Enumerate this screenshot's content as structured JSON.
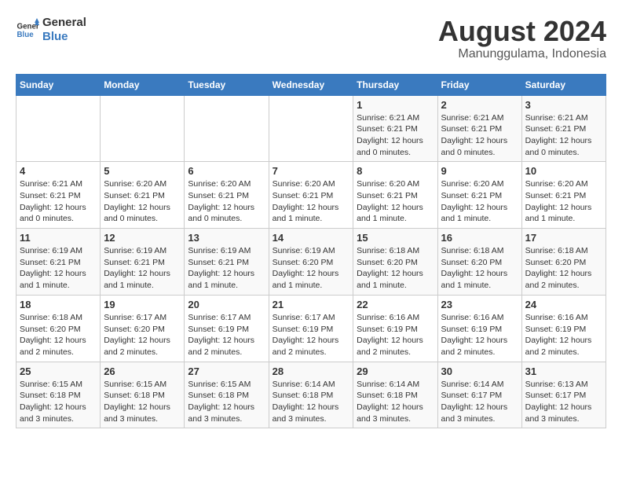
{
  "logo": {
    "line1": "General",
    "line2": "Blue"
  },
  "title": "August 2024",
  "subtitle": "Manunggulama, Indonesia",
  "header": {
    "days": [
      "Sunday",
      "Monday",
      "Tuesday",
      "Wednesday",
      "Thursday",
      "Friday",
      "Saturday"
    ]
  },
  "weeks": [
    {
      "cells": [
        {
          "day": "",
          "info": ""
        },
        {
          "day": "",
          "info": ""
        },
        {
          "day": "",
          "info": ""
        },
        {
          "day": "",
          "info": ""
        },
        {
          "day": "1",
          "info": "Sunrise: 6:21 AM\nSunset: 6:21 PM\nDaylight: 12 hours\nand 0 minutes."
        },
        {
          "day": "2",
          "info": "Sunrise: 6:21 AM\nSunset: 6:21 PM\nDaylight: 12 hours\nand 0 minutes."
        },
        {
          "day": "3",
          "info": "Sunrise: 6:21 AM\nSunset: 6:21 PM\nDaylight: 12 hours\nand 0 minutes."
        }
      ]
    },
    {
      "cells": [
        {
          "day": "4",
          "info": "Sunrise: 6:21 AM\nSunset: 6:21 PM\nDaylight: 12 hours\nand 0 minutes."
        },
        {
          "day": "5",
          "info": "Sunrise: 6:20 AM\nSunset: 6:21 PM\nDaylight: 12 hours\nand 0 minutes."
        },
        {
          "day": "6",
          "info": "Sunrise: 6:20 AM\nSunset: 6:21 PM\nDaylight: 12 hours\nand 0 minutes."
        },
        {
          "day": "7",
          "info": "Sunrise: 6:20 AM\nSunset: 6:21 PM\nDaylight: 12 hours\nand 1 minute."
        },
        {
          "day": "8",
          "info": "Sunrise: 6:20 AM\nSunset: 6:21 PM\nDaylight: 12 hours\nand 1 minute."
        },
        {
          "day": "9",
          "info": "Sunrise: 6:20 AM\nSunset: 6:21 PM\nDaylight: 12 hours\nand 1 minute."
        },
        {
          "day": "10",
          "info": "Sunrise: 6:20 AM\nSunset: 6:21 PM\nDaylight: 12 hours\nand 1 minute."
        }
      ]
    },
    {
      "cells": [
        {
          "day": "11",
          "info": "Sunrise: 6:19 AM\nSunset: 6:21 PM\nDaylight: 12 hours\nand 1 minute."
        },
        {
          "day": "12",
          "info": "Sunrise: 6:19 AM\nSunset: 6:21 PM\nDaylight: 12 hours\nand 1 minute."
        },
        {
          "day": "13",
          "info": "Sunrise: 6:19 AM\nSunset: 6:21 PM\nDaylight: 12 hours\nand 1 minute."
        },
        {
          "day": "14",
          "info": "Sunrise: 6:19 AM\nSunset: 6:20 PM\nDaylight: 12 hours\nand 1 minute."
        },
        {
          "day": "15",
          "info": "Sunrise: 6:18 AM\nSunset: 6:20 PM\nDaylight: 12 hours\nand 1 minute."
        },
        {
          "day": "16",
          "info": "Sunrise: 6:18 AM\nSunset: 6:20 PM\nDaylight: 12 hours\nand 1 minute."
        },
        {
          "day": "17",
          "info": "Sunrise: 6:18 AM\nSunset: 6:20 PM\nDaylight: 12 hours\nand 2 minutes."
        }
      ]
    },
    {
      "cells": [
        {
          "day": "18",
          "info": "Sunrise: 6:18 AM\nSunset: 6:20 PM\nDaylight: 12 hours\nand 2 minutes."
        },
        {
          "day": "19",
          "info": "Sunrise: 6:17 AM\nSunset: 6:20 PM\nDaylight: 12 hours\nand 2 minutes."
        },
        {
          "day": "20",
          "info": "Sunrise: 6:17 AM\nSunset: 6:19 PM\nDaylight: 12 hours\nand 2 minutes."
        },
        {
          "day": "21",
          "info": "Sunrise: 6:17 AM\nSunset: 6:19 PM\nDaylight: 12 hours\nand 2 minutes."
        },
        {
          "day": "22",
          "info": "Sunrise: 6:16 AM\nSunset: 6:19 PM\nDaylight: 12 hours\nand 2 minutes."
        },
        {
          "day": "23",
          "info": "Sunrise: 6:16 AM\nSunset: 6:19 PM\nDaylight: 12 hours\nand 2 minutes."
        },
        {
          "day": "24",
          "info": "Sunrise: 6:16 AM\nSunset: 6:19 PM\nDaylight: 12 hours\nand 2 minutes."
        }
      ]
    },
    {
      "cells": [
        {
          "day": "25",
          "info": "Sunrise: 6:15 AM\nSunset: 6:18 PM\nDaylight: 12 hours\nand 3 minutes."
        },
        {
          "day": "26",
          "info": "Sunrise: 6:15 AM\nSunset: 6:18 PM\nDaylight: 12 hours\nand 3 minutes."
        },
        {
          "day": "27",
          "info": "Sunrise: 6:15 AM\nSunset: 6:18 PM\nDaylight: 12 hours\nand 3 minutes."
        },
        {
          "day": "28",
          "info": "Sunrise: 6:14 AM\nSunset: 6:18 PM\nDaylight: 12 hours\nand 3 minutes."
        },
        {
          "day": "29",
          "info": "Sunrise: 6:14 AM\nSunset: 6:18 PM\nDaylight: 12 hours\nand 3 minutes."
        },
        {
          "day": "30",
          "info": "Sunrise: 6:14 AM\nSunset: 6:17 PM\nDaylight: 12 hours\nand 3 minutes."
        },
        {
          "day": "31",
          "info": "Sunrise: 6:13 AM\nSunset: 6:17 PM\nDaylight: 12 hours\nand 3 minutes."
        }
      ]
    }
  ]
}
